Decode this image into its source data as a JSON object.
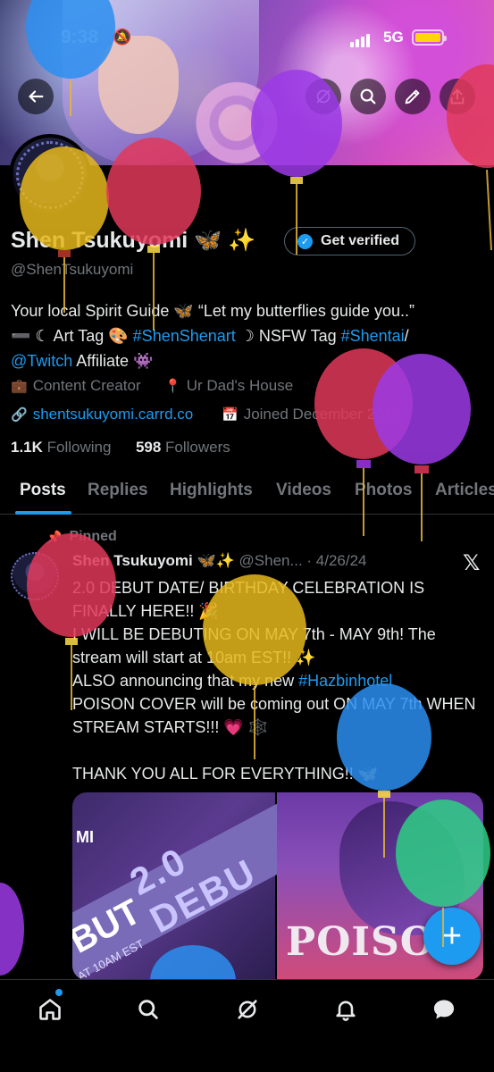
{
  "status_bar": {
    "time": "9:38",
    "network": "5G"
  },
  "header": {
    "back_label": "Back",
    "actions": [
      "grok-icon",
      "search-icon",
      "edit-icon",
      "share-icon"
    ]
  },
  "profile": {
    "name": "Shen Tsukuyomi 🦋 ✨",
    "verify_button": "Get verified",
    "handle": "@ShenTsukuyomi",
    "bio_line1": "Your local Spirit Guide 🦋 “Let my butterflies guide you..”",
    "bio_line2_a": "➖ ☾ Art Tag 🎨 ",
    "bio_line2_tag1": "#ShenShenart",
    "bio_line2_b": " ☽ NSFW Tag ",
    "bio_line2_tag2": "#Shentai",
    "bio_line2_c": "/",
    "bio_line3_link": "@Twitch",
    "bio_line3_b": " Affiliate 👾",
    "category": "Content Creator",
    "location": "Ur Dad's House",
    "website": "shentsukuyomi.carrd.co",
    "joined": "Joined December 2019",
    "following_count": "1.1K",
    "following_label": " Following",
    "followers_count": "598",
    "followers_label": " Followers"
  },
  "tabs": [
    "Posts",
    "Replies",
    "Highlights",
    "Videos",
    "Photos",
    "Articles"
  ],
  "active_tab": "Posts",
  "pinned_post": {
    "pinned_label": "Pinned",
    "author_name": "Shen Tsukuyomi 🦋✨",
    "author_handle": " @Shen... · 4/26/24",
    "text_1": "2.0 DEBUT DATE/ BIRTHDAY CELEBRATION IS FINALLY HERE!! 🎉\nI WILL BE DEBUTING ON MAY 7th - MAY 9th! The stream will start at 10am EST!! ✨\nALSO announcing that my new ",
    "text_link": "#Hazbinhotel",
    "text_2": "\nPOISON COVER will be coming out ON MAY 7th WHEN STREAM STARTS!!! 💗 🕸️\n\nTHANK YOU ALL FOR EVERYTHING!! 🦋",
    "media_left_text_1": "2.0 DEBU",
    "media_left_text_2": "BUT",
    "media_left_text_3": "AT 10AM EST",
    "media_left_text_4": "MI",
    "media_right_text": "POISON"
  },
  "fab_label": "+",
  "bottom_nav": [
    "home-icon",
    "search-icon",
    "grok-icon",
    "notifications-icon",
    "messages-icon"
  ],
  "colors": {
    "accent": "#1d9bf0",
    "background": "#000000",
    "muted": "#71767b"
  }
}
